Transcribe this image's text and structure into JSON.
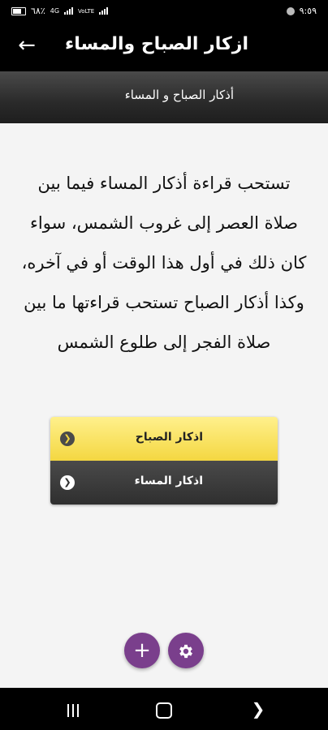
{
  "status_bar": {
    "battery": "٦٨٪",
    "network_1": "4G",
    "network_2": "VoLTE",
    "time": "٩:٥٩"
  },
  "app_bar": {
    "title": "ازكار الصباح والمساء",
    "back_icon": "arrow-left-icon"
  },
  "sub_header": {
    "text": "أذكار الصباح و المساء"
  },
  "description": "تستحب قراءة أذكار المساء فيما بين صلاة العصر إلى غروب الشمس، سواء كان ذلك في أول هذا الوقت أو في آخره، وكذا أذكار الصباح تستحب قراءتها ما بين صلاة الفجر إلى طلوع الشمس",
  "menu": {
    "items": [
      {
        "label": "اذكار الصباح",
        "color": "#f4d741"
      },
      {
        "label": "اذكار المساء",
        "color": "#2f2f2f"
      }
    ]
  },
  "fabs": {
    "add_icon": "plus-icon",
    "settings_icon": "gear-icon",
    "color": "#7a3f8c"
  }
}
